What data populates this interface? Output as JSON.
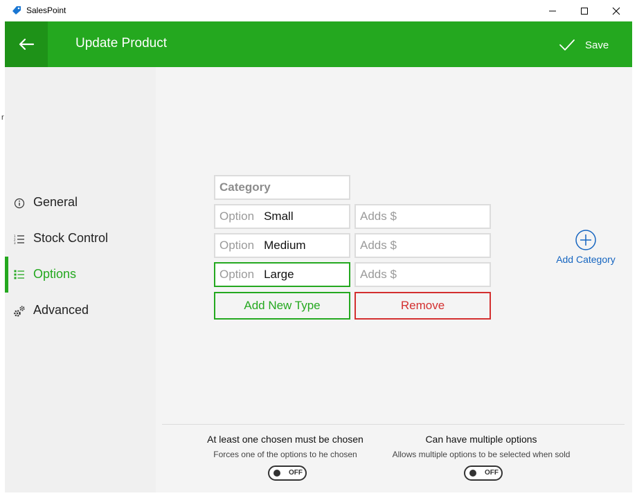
{
  "window": {
    "app_title": "SalesPoint",
    "icons": {
      "logo": "tag-icon",
      "minimize": "minimize-icon",
      "maximize": "maximize-icon",
      "close": "close-icon"
    }
  },
  "header": {
    "title": "Update Product",
    "save_label": "Save",
    "background": "#24a81f",
    "back_background": "#1e9218"
  },
  "sidebar": {
    "stray_text": "r",
    "active_index": 2,
    "items": [
      {
        "label": "General",
        "icon": "info-icon"
      },
      {
        "label": "Stock Control",
        "icon": "numbered-list-icon"
      },
      {
        "label": "Options",
        "icon": "bulleted-list-icon"
      },
      {
        "label": "Advanced",
        "icon": "gears-icon"
      }
    ]
  },
  "options_editor": {
    "category_placeholder": "Category",
    "option_placeholder": "Option",
    "adds_placeholder": "Adds $",
    "options": [
      {
        "value": "Small",
        "adds": "",
        "focused": false
      },
      {
        "value": "Medium",
        "adds": "",
        "focused": false
      },
      {
        "value": "Large",
        "adds": "",
        "focused": true
      }
    ],
    "add_new_type_label": "Add New Type",
    "remove_label": "Remove"
  },
  "add_category": {
    "label": "Add Category"
  },
  "settings": {
    "required": {
      "title": "At least one chosen must be chosen",
      "description": "Forces one of the options to he chosen",
      "state": "OFF"
    },
    "multiple": {
      "title": "Can have multiple options",
      "description": "Allows multiple options to be selected when sold",
      "state": "OFF"
    }
  },
  "colors": {
    "accent": "#24a81f",
    "danger": "#d32f2f",
    "link": "#1565c0"
  }
}
